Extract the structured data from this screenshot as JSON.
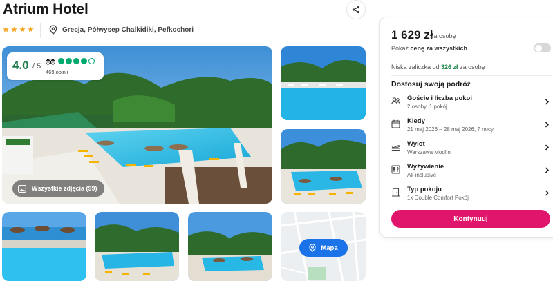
{
  "hotel": {
    "name": "Atrium Hotel",
    "stars": 4,
    "location": "Grecja, Półwysep Chalkidiki, Pefkochori"
  },
  "rating": {
    "score": "4.0",
    "max": "/ 5",
    "filled_dots": 4,
    "total_dots": 5,
    "reviews": "469 opinii"
  },
  "gallery": {
    "all_photos_label": "Wszystkie zdjęcia (99)",
    "map_label": "Mapa"
  },
  "booking": {
    "price": "1 629 zł",
    "per_person": "za osobę",
    "toggle_prefix": "Pokaż ",
    "toggle_bold": "cenę za wszystkich",
    "toggle_on": false,
    "deposit_prefix": "Niska zaliczka od ",
    "deposit_amount": "326 zł",
    "deposit_suffix": " za osobę",
    "customize_title": "Dostosuj swoją podróż",
    "options": [
      {
        "icon": "guests-icon",
        "label": "Goście i liczba pokoi",
        "value": "2 osoby, 1 pokój"
      },
      {
        "icon": "calendar-icon",
        "label": "Kiedy",
        "value": "21 maj 2026 – 28 maj 2026, 7 nocy"
      },
      {
        "icon": "plane-icon",
        "label": "Wylot",
        "value": "Warszawa Modlin"
      },
      {
        "icon": "meal-icon",
        "label": "Wyżywienie",
        "value": "All-inclusive"
      },
      {
        "icon": "door-icon",
        "label": "Typ pokoju",
        "value": "1x Double Comfort Pokój"
      }
    ],
    "continue_label": "Kontynuuj"
  },
  "colors": {
    "accent_pink": "#e2156d",
    "rating_green": "#1f7a4d",
    "tripadvisor_green": "#00aa6c",
    "map_blue": "#1a73e8",
    "star_orange": "#f5a623"
  }
}
